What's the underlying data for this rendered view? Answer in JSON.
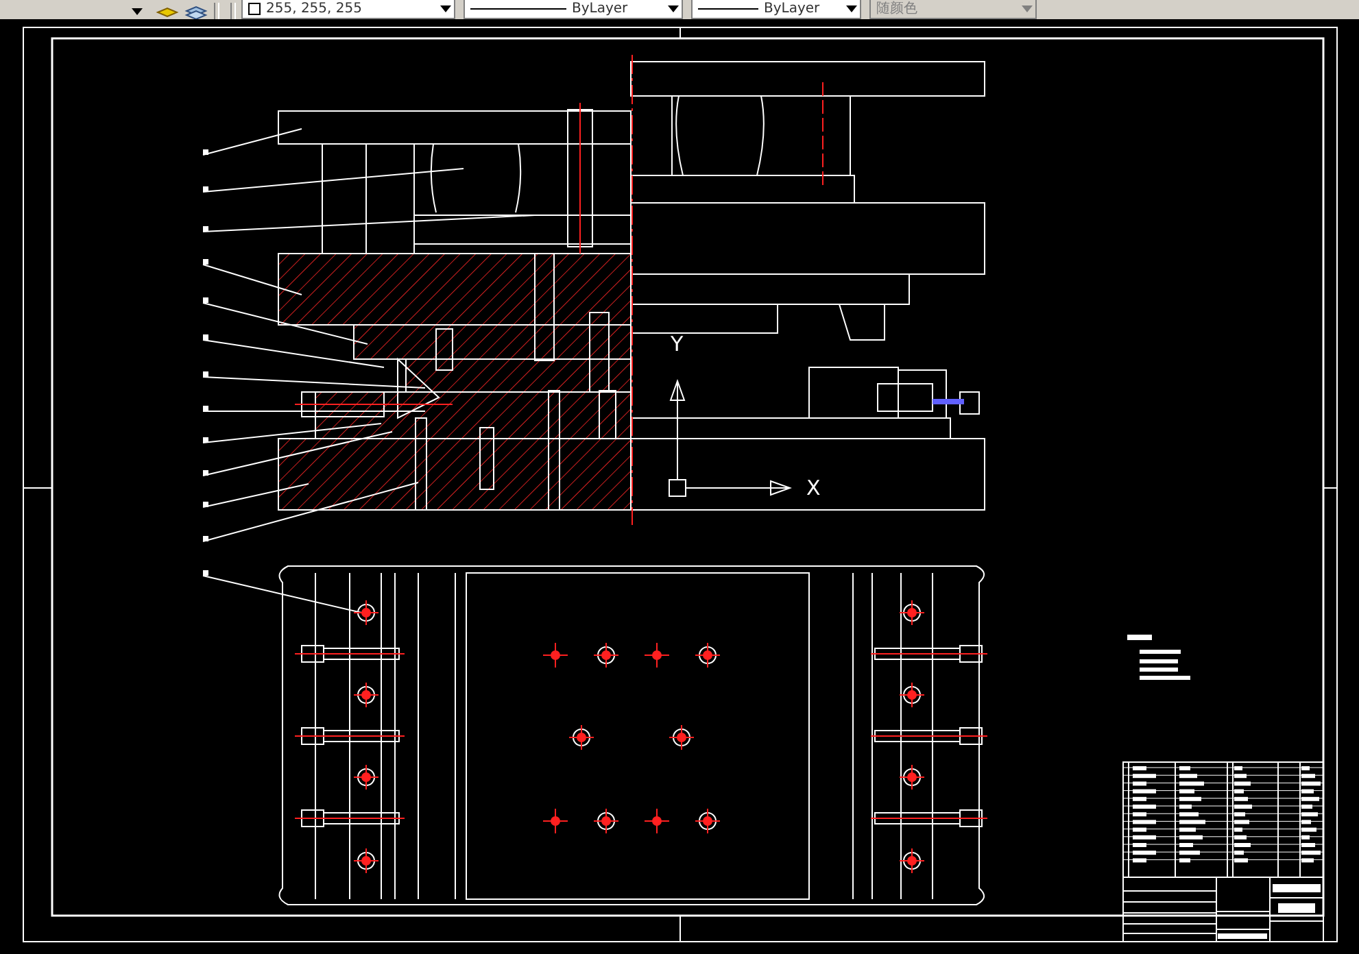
{
  "toolbar": {
    "color_combo": {
      "value": "255, 255, 255"
    },
    "linetype_combo": {
      "value": "ByLayer"
    },
    "lineweight_combo": {
      "value": "ByLayer"
    },
    "plotstyle_combo": {
      "value": "随颜色",
      "disabled": true
    }
  },
  "canvas": {
    "ucs_icon": {
      "y_label": "Y",
      "x_label": "X"
    }
  }
}
